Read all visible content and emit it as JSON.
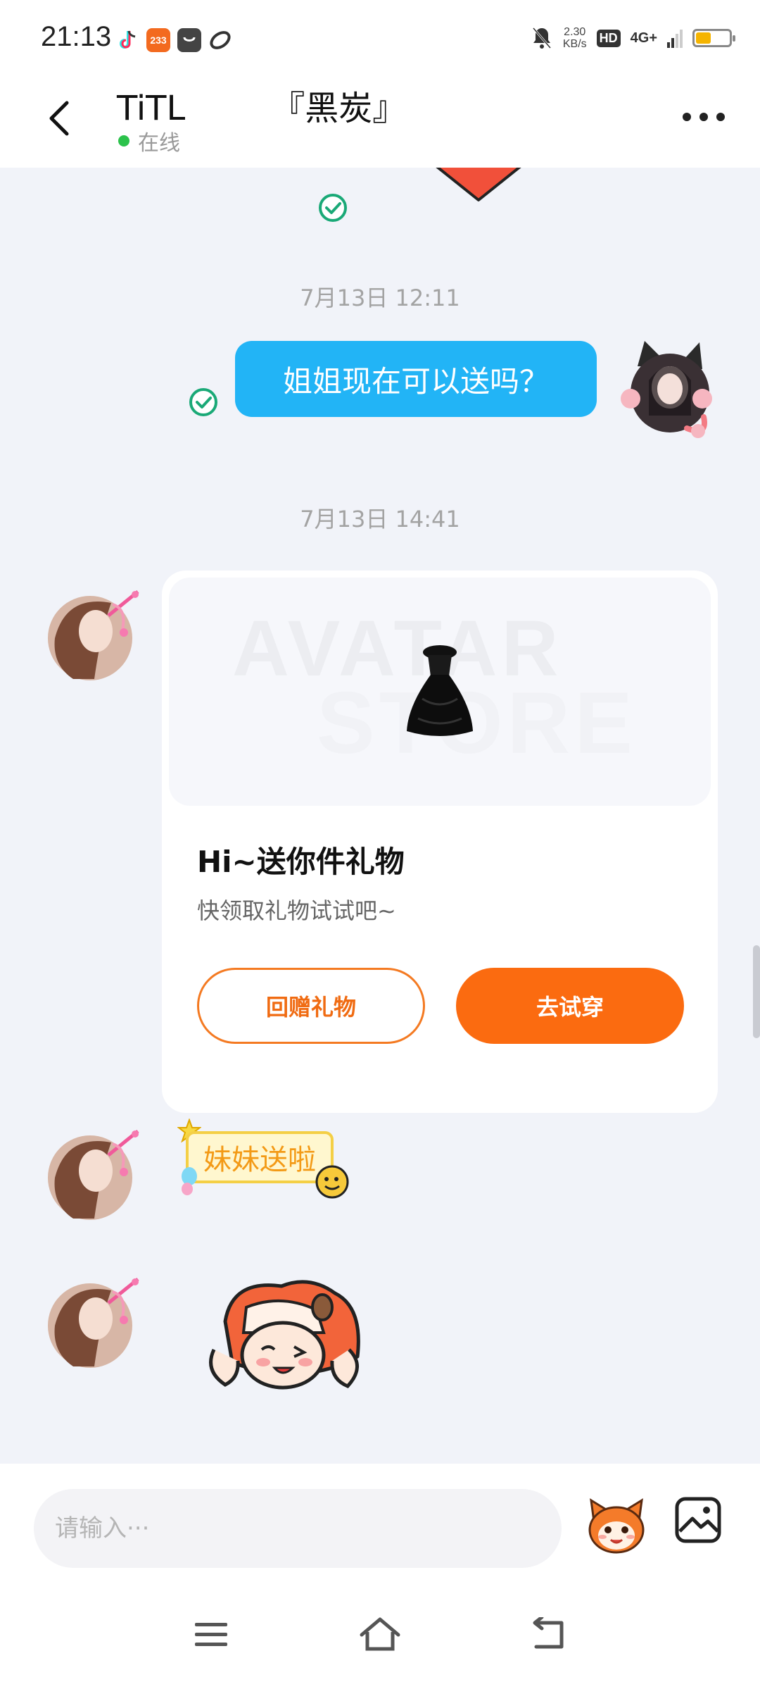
{
  "status_bar": {
    "time": "21:13",
    "app_icons": [
      "tiktok-icon",
      "233-app-icon",
      "bag-app-icon",
      "link-app-icon"
    ],
    "net_speed_value": "2.30",
    "net_speed_unit": "KB/s",
    "hd_label": "HD",
    "network": "4G+",
    "battery_level": 0.45
  },
  "header": {
    "contact_name": "TiTL        『黑炭』",
    "status": "在线"
  },
  "chat": {
    "timestamps": [
      "7月13日 12:11",
      "7月13日 14:41"
    ],
    "outgoing_message": "姐姐现在可以送吗？",
    "gift_card": {
      "banner_text_1": "AVATAR",
      "banner_text_2": "STORE",
      "title": "Hi~送你件礼物",
      "subtitle": "快领取礼物试试吧~",
      "return_gift_label": "回赠礼物",
      "try_on_label": "去试穿"
    },
    "sticker_text": "妹妹送啦"
  },
  "input": {
    "placeholder": "请输入···"
  },
  "colors": {
    "accent_blue": "#22b4f6",
    "accent_orange": "#fb6b10",
    "check_green": "#1aa977",
    "online_green": "#2bc24b"
  }
}
